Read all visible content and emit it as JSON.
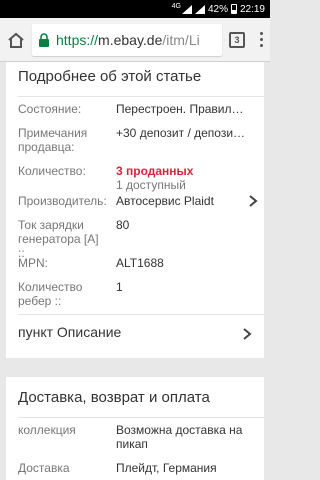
{
  "status": {
    "signal_label": "4G",
    "battery": "42%",
    "time": "22:19"
  },
  "browser": {
    "url_scheme": "https://",
    "url_host": "m.ebay.de",
    "url_path": "/itm/Li",
    "tab_count": "3"
  },
  "details": {
    "title": "Подробнее об этой статье",
    "rows": [
      {
        "label": "Состояние:",
        "value": "Перестроен. Правильн..."
      },
      {
        "label": "Примечания продавца:",
        "value": "+30 депозит / депозит ..."
      },
      {
        "label": "Количество:",
        "value": "3 проданных",
        "sub": "1 доступный"
      },
      {
        "label": "Производитель:",
        "value": "Автосервис Plaidt"
      },
      {
        "label": "Ток зарядки генератора [A] ::",
        "value": "80"
      },
      {
        "label": "MPN:",
        "value": "ALT1688"
      },
      {
        "label": "Количество ребер ::",
        "value": "1"
      }
    ],
    "description_link": "пункт Описание"
  },
  "shipping": {
    "title": "Доставка, возврат и оплата",
    "rows": [
      {
        "label": "коллекция",
        "value": "Возможна доставка на пикап"
      },
      {
        "label": "Доставка",
        "value": "Плейдт, Германия"
      }
    ]
  },
  "colors": {
    "sold_red": "#d8243c",
    "secure_green": "#0b8043"
  }
}
